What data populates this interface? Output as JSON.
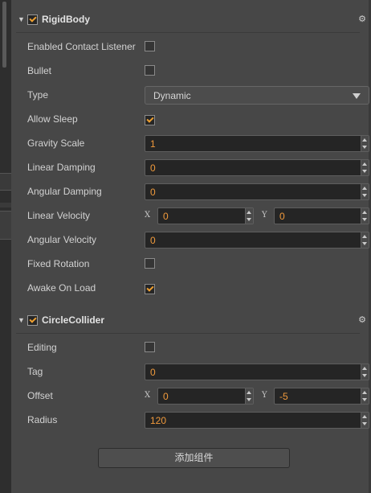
{
  "rigidbody": {
    "title": "RigidBody",
    "enabled": true,
    "fields": {
      "enabled_contact_listener": {
        "label": "Enabled Contact Listener",
        "checked": false
      },
      "bullet": {
        "label": "Bullet",
        "checked": false
      },
      "type": {
        "label": "Type",
        "value": "Dynamic"
      },
      "allow_sleep": {
        "label": "Allow Sleep",
        "checked": true
      },
      "gravity_scale": {
        "label": "Gravity Scale",
        "value": "1"
      },
      "linear_damping": {
        "label": "Linear Damping",
        "value": "0"
      },
      "angular_damping": {
        "label": "Angular Damping",
        "value": "0"
      },
      "linear_velocity": {
        "label": "Linear Velocity",
        "x_label": "X",
        "x": "0",
        "y_label": "Y",
        "y": "0"
      },
      "angular_velocity": {
        "label": "Angular Velocity",
        "value": "0"
      },
      "fixed_rotation": {
        "label": "Fixed Rotation",
        "checked": false
      },
      "awake_on_load": {
        "label": "Awake On Load",
        "checked": true
      }
    }
  },
  "circlecollider": {
    "title": "CircleCollider",
    "enabled": true,
    "fields": {
      "editing": {
        "label": "Editing",
        "checked": false
      },
      "tag": {
        "label": "Tag",
        "value": "0"
      },
      "offset": {
        "label": "Offset",
        "x_label": "X",
        "x": "0",
        "y_label": "Y",
        "y": "-5"
      },
      "radius": {
        "label": "Radius",
        "value": "120"
      }
    }
  },
  "add_component_label": "添加组件",
  "colors": {
    "accent": "#f0a030",
    "value_text": "#f09a3c",
    "panel_bg": "#474747"
  },
  "icons": {
    "collapse": "triangle-down-icon",
    "settings": "gear-icon"
  }
}
